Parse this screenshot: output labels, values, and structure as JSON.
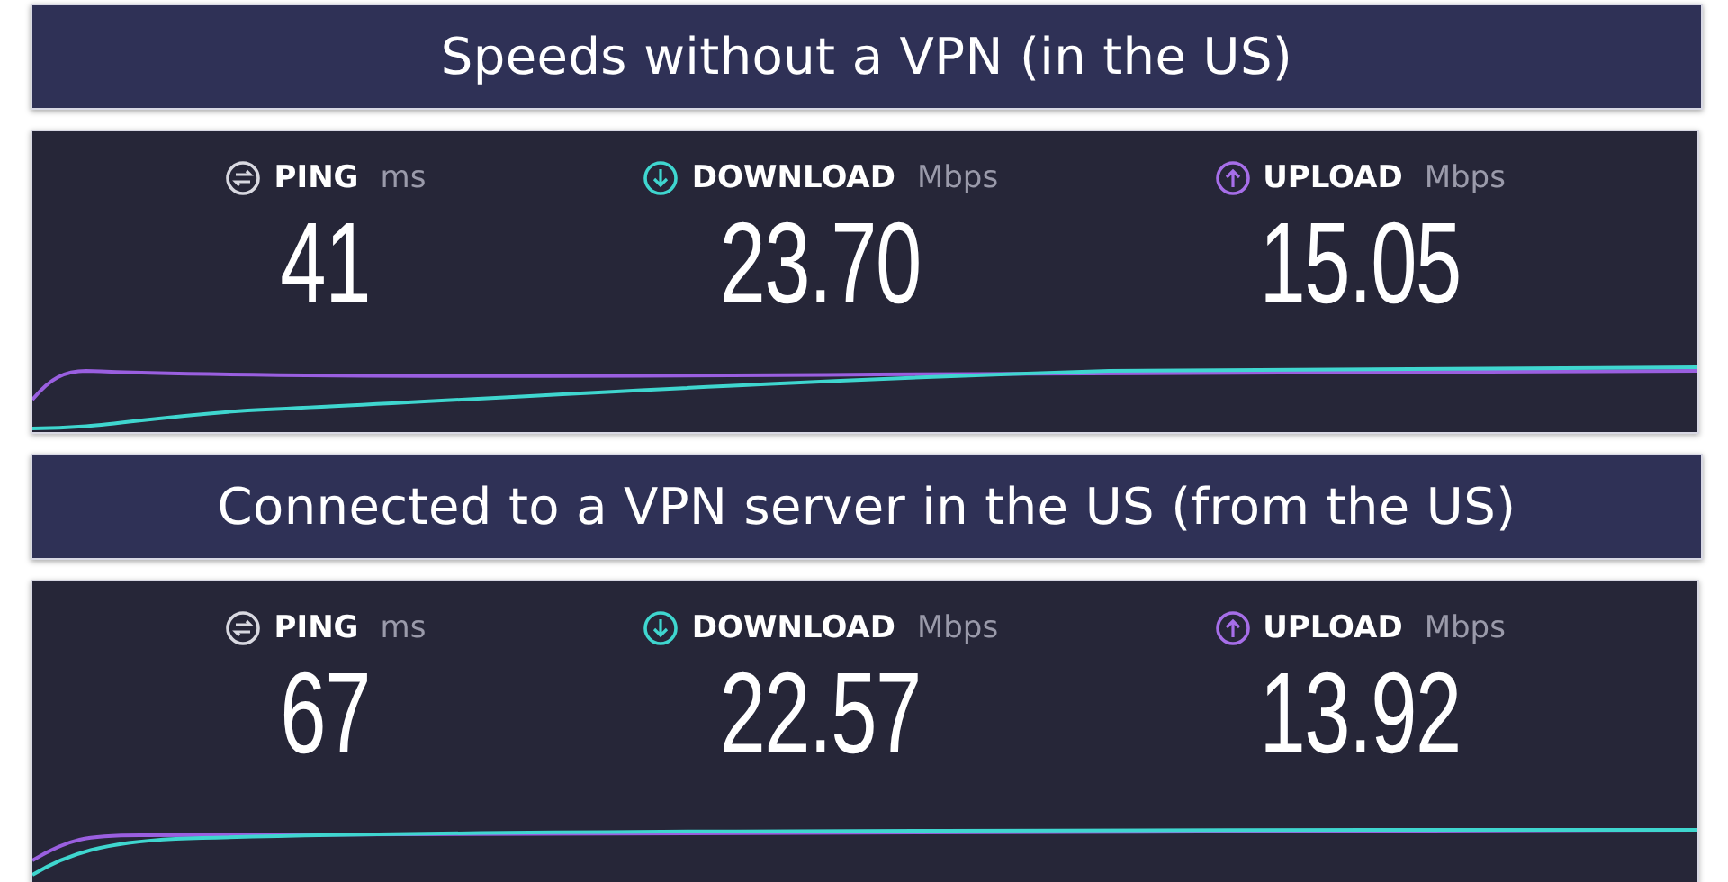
{
  "sections": [
    {
      "heading": "Speeds without a VPN (in the US)",
      "metrics": [
        {
          "kind": "ping",
          "label": "PING",
          "unit": "ms",
          "value": "41"
        },
        {
          "kind": "download",
          "label": "DOWNLOAD",
          "unit": "Mbps",
          "value": "23.70"
        },
        {
          "kind": "upload",
          "label": "UPLOAD",
          "unit": "Mbps",
          "value": "15.05"
        }
      ]
    },
    {
      "heading": "Connected to a VPN server in the US (from the US)",
      "metrics": [
        {
          "kind": "ping",
          "label": "PING",
          "unit": "ms",
          "value": "67"
        },
        {
          "kind": "download",
          "label": "DOWNLOAD",
          "unit": "Mbps",
          "value": "22.57"
        },
        {
          "kind": "upload",
          "label": "UPLOAD",
          "unit": "Mbps",
          "value": "13.92"
        }
      ]
    }
  ]
}
